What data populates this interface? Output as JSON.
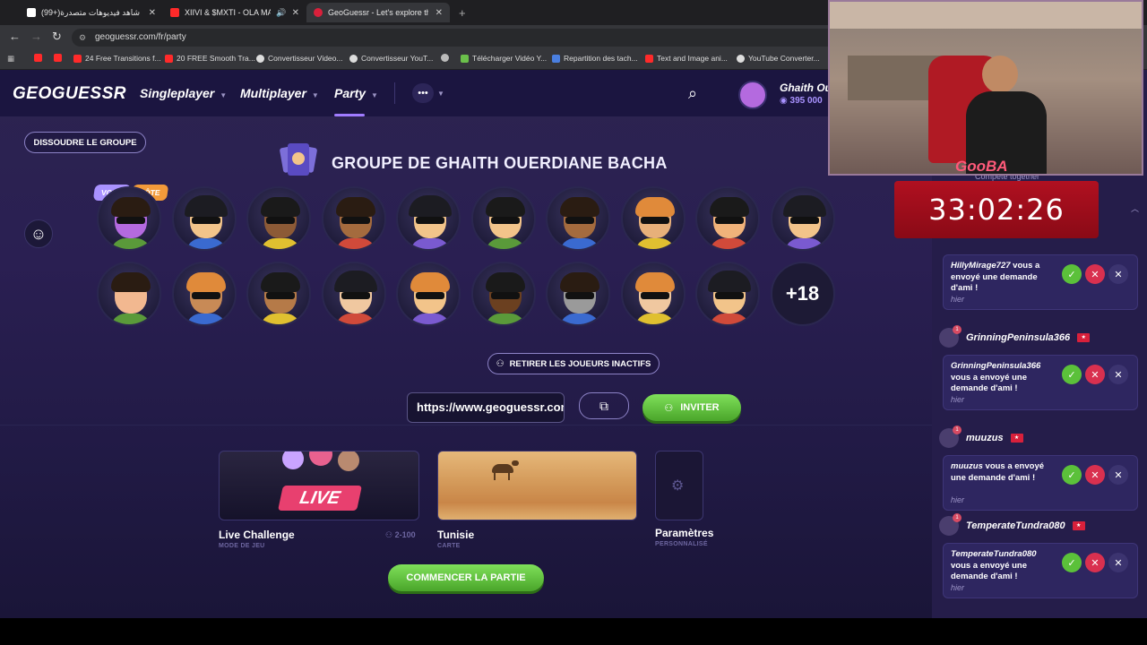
{
  "browser": {
    "tabs": [
      {
        "label": "(99+)شاهد فيديوهات متصدرة |",
        "color": "#ffffff"
      },
      {
        "label": "XIIVI & $MXTI - OLA MAMA",
        "color": "#ff2a2a"
      },
      {
        "label": "GeoGuessr - Let's explore the w",
        "color": "#d9203b"
      }
    ],
    "new_tab": "+",
    "url": "geoguessr.com/fr/party",
    "bookmarks": [
      {
        "label": "",
        "color": "#ff2a2a"
      },
      {
        "label": "",
        "color": "#ff2a2a"
      },
      {
        "label": "24 Free Transitions f...",
        "color": "#ff2a2a"
      },
      {
        "label": "20 FREE Smooth Tra...",
        "color": "#ff2a2a"
      },
      {
        "label": "Convertisseur Video...",
        "color": "#dddddd"
      },
      {
        "label": "Convertisseur YouT...",
        "color": "#dddddd"
      },
      {
        "label": "",
        "color": "#bbbbbb"
      },
      {
        "label": "Télécharger Vidéo Y...",
        "color": "#6bc04b"
      },
      {
        "label": "Repartition des tach...",
        "color": "#4a7fe0"
      },
      {
        "label": "Text and Image ani...",
        "color": "#ff2a2a"
      },
      {
        "label": "YouTube Converter...",
        "color": "#dddddd"
      }
    ]
  },
  "header": {
    "logo": "GEOGUESSR",
    "nav": [
      "Singleplayer",
      "Multiplayer",
      "Party"
    ],
    "more": "•••",
    "user_name": "Ghaith Ou",
    "user_coins": "395 000"
  },
  "party": {
    "disband_label": "DISSOUDRE LE GROUPE",
    "title": "GROUPE DE GHAITH OUERDIANE BACHA",
    "badge_you": "VOUS",
    "badge_host": "HÔTE",
    "more_players": "+18",
    "remove_inactive_label": "RETIRER LES JOUEURS INACTIFS",
    "invite_url": "https://www.geoguessr.com/fr/party",
    "invite_label": "INVITER",
    "start_label": "COMMENCER LA PARTIE",
    "avatars_row1": [
      "#b46adf",
      "#f2c48a",
      "#8c5a36",
      "#a46b3e",
      "#f2c48a",
      "#f2c48a",
      "#a46b3e",
      "#e7b07a",
      "#f0b27a",
      "#f2c48a"
    ],
    "avatars_row2": [
      "#f2b890",
      "#c88a56",
      "#b57a48",
      "#f0c8a0",
      "#f2c48a",
      "#6b4020",
      "#9a9a9a",
      "#f0c8a0",
      "#f2c48a"
    ]
  },
  "cards": {
    "mode_title": "Live Challenge",
    "mode_sub": "MODE DE JEU",
    "mode_badge": "LIVE",
    "players_range": "2-100",
    "map_title": "Tunisie",
    "map_sub": "CARTE",
    "settings_title": "Paramètres",
    "settings_sub": "PERSONNALISÉ"
  },
  "notifications": [
    {
      "name": "HillyMirage727",
      "user": "HillyMirage727",
      "text": " vous a envoyé une demande d'ami !",
      "time": "hier"
    },
    {
      "name": "GrinningPeninsula366",
      "user": "GrinningPeninsula366",
      "text": " vous a envoyé une demande d'ami !",
      "time": "hier"
    },
    {
      "name": "muuzus",
      "user": "muuzus",
      "text": " vous a envoyé une demande d'ami !",
      "time": "hier"
    },
    {
      "name": "TemperateTundra080",
      "user": "TemperateTundra080",
      "text": " vous a envoyé une demande d'ami !",
      "time": "hier"
    }
  ],
  "panel_header": "Compete together",
  "overlay": {
    "streamer_logo": "GooBA",
    "timer": "33:02:26"
  }
}
